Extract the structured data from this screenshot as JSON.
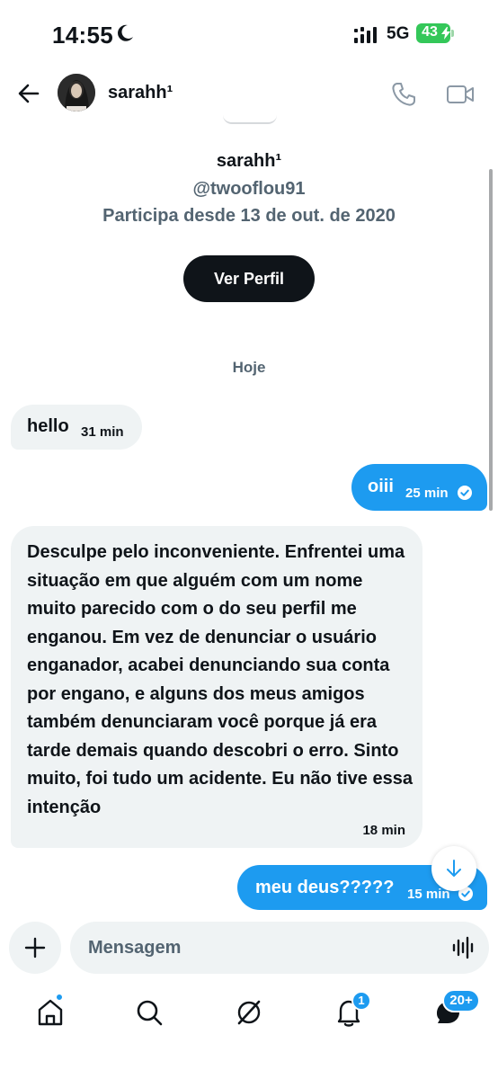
{
  "status_bar": {
    "time": "14:55",
    "network": "5G",
    "battery": "43"
  },
  "header": {
    "name": "sarahh¹"
  },
  "profile": {
    "name": "sarahh¹",
    "handle": "@twooflou91",
    "joined": "Participa desde 13 de out. de 2020",
    "view_profile_label": "Ver Perfil"
  },
  "day_separator": "Hoje",
  "messages": [
    {
      "direction": "incoming",
      "text": "hello",
      "time": "31 min"
    },
    {
      "direction": "outgoing",
      "text": "oiii",
      "time": "25 min"
    },
    {
      "direction": "incoming",
      "text": "Desculpe pelo inconveniente. Enfrentei uma situação em que alguém com um nome muito parecido com o do seu perfil me enganou. Em vez de denunciar o usuário enganador, acabei denunciando sua conta por engano, e alguns dos meus amigos também denunciaram você porque já era tarde demais quando descobri o erro. Sinto muito, foi tudo um acidente. Eu não tive essa intenção",
      "time": "18 min"
    },
    {
      "direction": "outgoing",
      "text": "meu deus?????",
      "time": "15 min"
    }
  ],
  "composer": {
    "placeholder": "Mensagem"
  },
  "nav": {
    "notifications_badge": "1",
    "messages_badge": "20+"
  },
  "colors": {
    "accent": "#1d9bf0",
    "incoming_bubble": "#eff3f4",
    "text": "#0f1419",
    "muted": "#536471",
    "battery": "#34c759"
  }
}
